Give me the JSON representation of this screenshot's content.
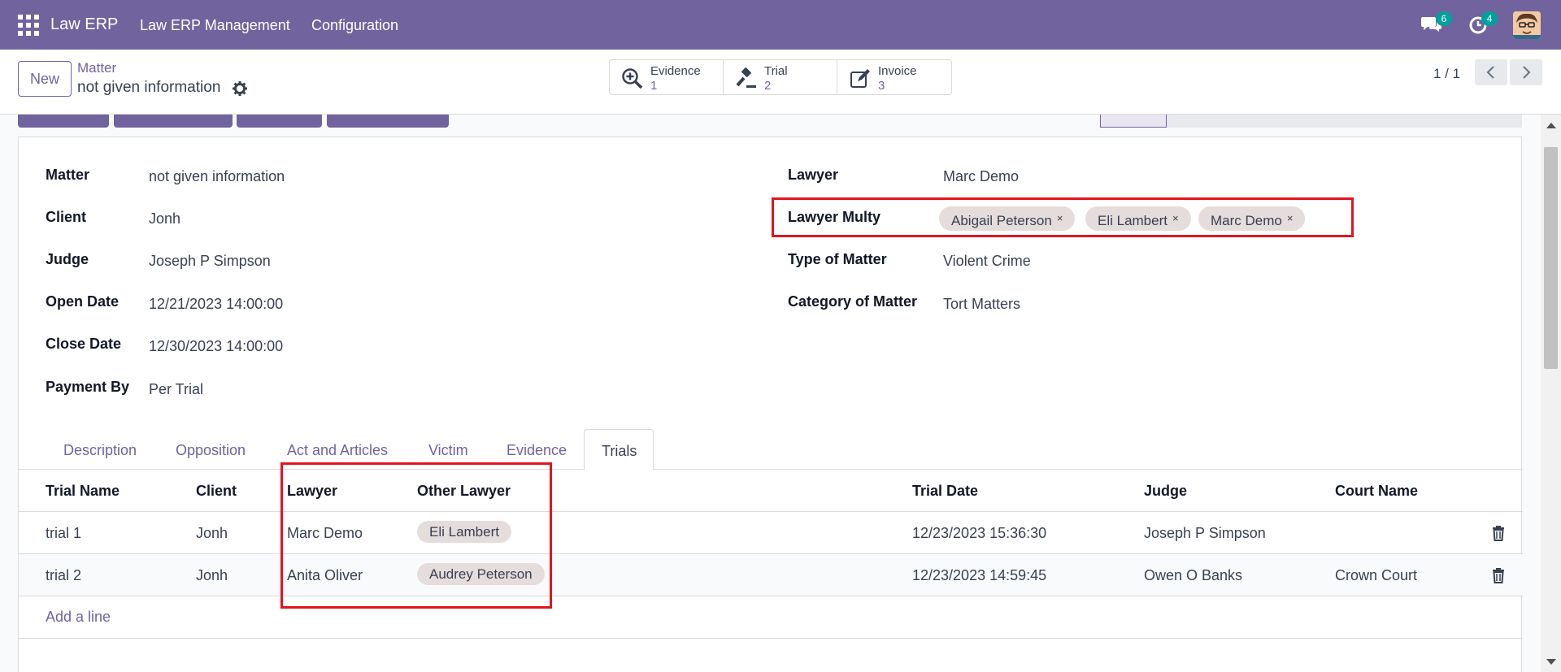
{
  "navbar": {
    "brand": "Law ERP",
    "menus": [
      "Law ERP Management",
      "Configuration"
    ],
    "messages_badge": "6",
    "activities_badge": "4",
    "bg_color": "#71639e"
  },
  "control": {
    "new_label": "New",
    "breadcrumb_parent": "Matter",
    "breadcrumb_current": "not given information",
    "smart_buttons": [
      {
        "label": "Evidence",
        "count": "1",
        "icon": "search-plus-icon"
      },
      {
        "label": "Trial",
        "count": "2",
        "icon": "gavel-icon"
      },
      {
        "label": "Invoice",
        "count": "3",
        "icon": "edit-icon"
      }
    ],
    "pager": "1 / 1"
  },
  "form": {
    "left_fields": [
      {
        "label": "Matter",
        "value": "not given information"
      },
      {
        "label": "Client",
        "value": "Jonh"
      },
      {
        "label": "Judge",
        "value": "Joseph P Simpson"
      },
      {
        "label": "Open Date",
        "value": "12/21/2023 14:00:00"
      },
      {
        "label": "Close Date",
        "value": "12/30/2023 14:00:00"
      },
      {
        "label": "Payment By",
        "value": "Per Trial"
      }
    ],
    "right_fields": [
      {
        "label": "Lawyer",
        "value": "Marc Demo"
      },
      {
        "label": "Lawyer Multy",
        "value": ""
      },
      {
        "label": "Type of Matter",
        "value": "Violent Crime"
      },
      {
        "label": "Category of Matter",
        "value": "Tort Matters"
      }
    ],
    "lawyer_multy_tags": [
      "Abigail Peterson",
      "Eli Lambert",
      "Marc Demo"
    ],
    "tag_remove": "×",
    "highlight_color": "#e3141e"
  },
  "tabs": [
    "Description",
    "Opposition",
    "Act and Articles",
    "Victim",
    "Evidence",
    "Trials"
  ],
  "trials": {
    "columns": [
      "Trial Name",
      "Client",
      "Lawyer",
      "Other Lawyer",
      "Trial Date",
      "Judge",
      "Court Name"
    ],
    "rows": [
      {
        "name": "trial 1",
        "client": "Jonh",
        "lawyer": "Marc Demo",
        "other_lawyer": "Eli Lambert",
        "date": "12/23/2023 15:36:30",
        "judge": "Joseph P Simpson",
        "court": ""
      },
      {
        "name": "trial 2",
        "client": "Jonh",
        "lawyer": "Anita Oliver",
        "other_lawyer": "Audrey Peterson",
        "date": "12/23/2023 14:59:45",
        "judge": "Owen O Banks",
        "court": "Crown Court"
      }
    ],
    "add_line": "Add a line"
  }
}
